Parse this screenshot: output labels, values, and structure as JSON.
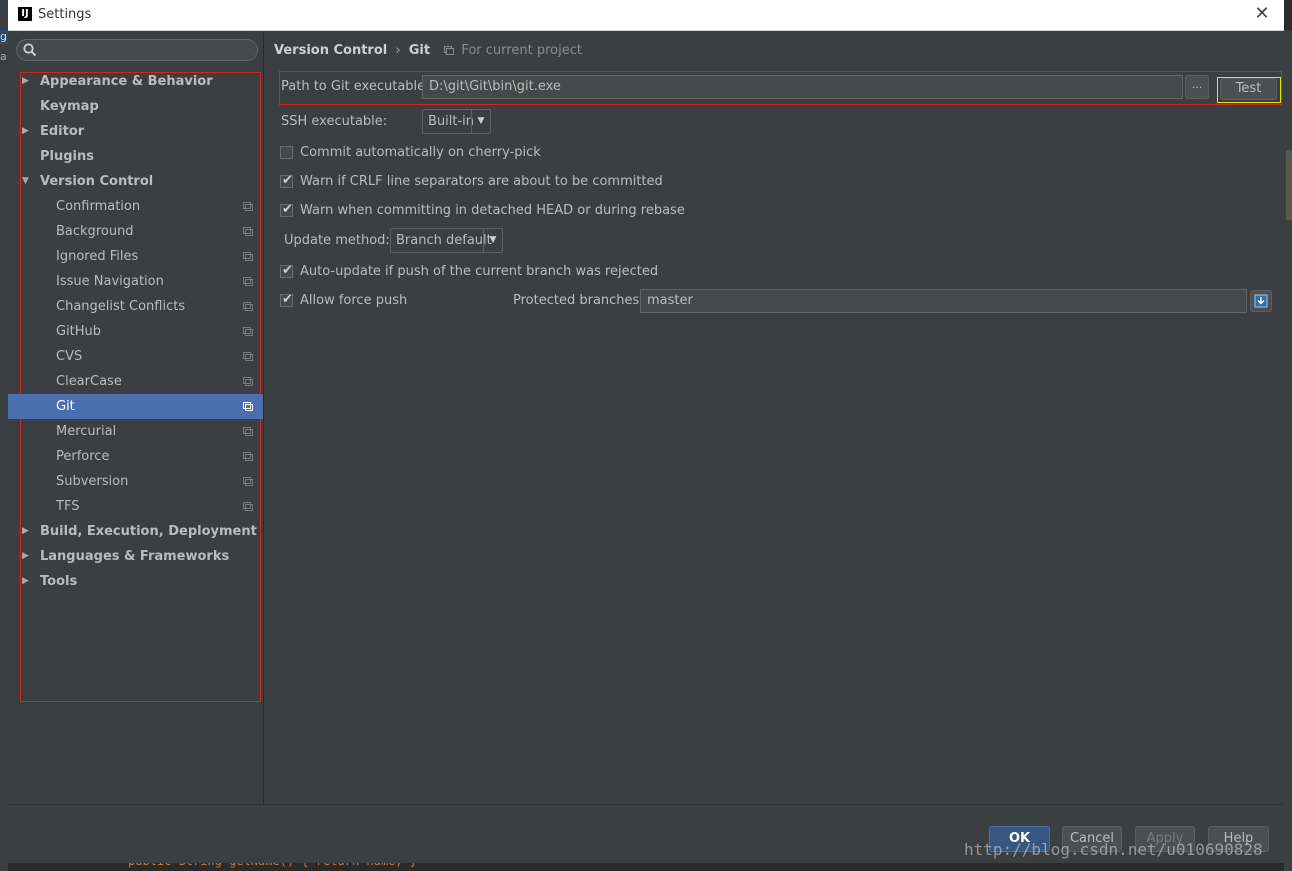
{
  "window": {
    "title": "Settings",
    "app_icon": "IJ"
  },
  "search": {
    "placeholder": ""
  },
  "sidebar": {
    "top_items": [
      {
        "label": "Appearance & Behavior",
        "expandable": true
      },
      {
        "label": "Keymap",
        "expandable": false
      },
      {
        "label": "Editor",
        "expandable": true
      },
      {
        "label": "Plugins",
        "expandable": false
      },
      {
        "label": "Version Control",
        "expandable": true,
        "expanded": true
      }
    ],
    "vc_children": [
      "Confirmation",
      "Background",
      "Ignored Files",
      "Issue Navigation",
      "Changelist Conflicts",
      "GitHub",
      "CVS",
      "ClearCase",
      "Git",
      "Mercurial",
      "Perforce",
      "Subversion",
      "TFS"
    ],
    "selected": "Git",
    "bottom_items": [
      {
        "label": "Build, Execution, Deployment",
        "expandable": true
      },
      {
        "label": "Languages & Frameworks",
        "expandable": true
      },
      {
        "label": "Tools",
        "expandable": true
      }
    ]
  },
  "breadcrumb": {
    "section": "Version Control",
    "separator": "›",
    "page": "Git",
    "scope": "For current project"
  },
  "git": {
    "path_label": "Path to Git executable:",
    "path_value": "D:\\git\\Git\\bin\\git.exe",
    "browse_label": "...",
    "test_label": "Test",
    "ssh_label": "SSH executable:",
    "ssh_value": "Built-in",
    "cherry_pick_label": "Commit automatically on cherry-pick",
    "cherry_pick_checked": false,
    "crlf_label": "Warn if CRLF line separators are about to be committed",
    "crlf_checked": true,
    "detached_label": "Warn when committing in detached HEAD or during rebase",
    "detached_checked": true,
    "update_method_label": "Update method:",
    "update_method_value": "Branch default",
    "auto_update_label": "Auto-update if push of the current branch was rejected",
    "auto_update_checked": true,
    "force_push_label": "Allow force push",
    "force_push_checked": true,
    "protected_label": "Protected branches:",
    "protected_value": "master"
  },
  "footer": {
    "ok": "OK",
    "cancel": "Cancel",
    "apply": "Apply",
    "help": "Help"
  },
  "background": {
    "code_line": "public String getName() { return name; }",
    "watermark": "http://blog.csdn.net/u010690828"
  },
  "colors": {
    "selection": "#4b6eaf",
    "highlight_frame": "#d0242b",
    "test_frame": "#e5e500",
    "ok_button": "#365880"
  }
}
